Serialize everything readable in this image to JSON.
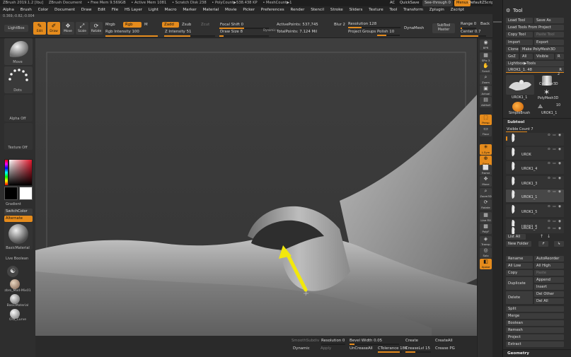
{
  "title_bar": {
    "app": "ZBrush 2019.1.2 [Ibu]",
    "document": "ZBrush Document",
    "free_mem": "• Free Mem 9.569GB",
    "active_mem": "• Active Mem 1081",
    "scratch_disk": "• Scratch Disk 238",
    "poly_count": "• PolyCount▶538.438 KP",
    "mesh_count": "• MeshCount▶1",
    "ac": "AC",
    "quicksave": "QuickSave",
    "see_through": "See-through  0",
    "menus": "Menus",
    "script": "DefaultZScript"
  },
  "menubar": [
    "Alpha",
    "Brush",
    "Color",
    "Document",
    "Draw",
    "Edit",
    "File",
    "HS Layer",
    "Light",
    "Macro",
    "Marker",
    "Material",
    "Movie",
    "Picker",
    "Preferences",
    "Render",
    "Stencil",
    "Stroke",
    "Sliders",
    "Texture",
    "Tool",
    "Transform",
    "Zplugin",
    "Zscript"
  ],
  "coords": "0.369,-0.82,-0.004",
  "top_toolbar": {
    "lightbox": "LightBox",
    "edit": "Edit",
    "draw": "Draw",
    "move": "Move",
    "scale": "Scale",
    "rotate": "Rotate",
    "mrgb": "Mrgb",
    "rgb": "Rgb",
    "m": "M",
    "rgb_intensity": "Rgb Intensity 100",
    "zadd": "Zadd",
    "zsub": "Zsub",
    "zcut": "Zcut",
    "z_intensity": "Z Intensity 51",
    "focal_shift": "Focal Shift 0",
    "draw_size": "Draw Size 8",
    "dynamic": "Dynamic",
    "active_points": "ActivePoints: 537,745",
    "total_points": "TotalPoints: 7.124 Mil",
    "blur": "Blur 2",
    "resolution": "Resolution 128",
    "project": "Project",
    "groups": "Groups",
    "polish": "Polish 10",
    "dynamesh": "DynaMesh",
    "subtool_master": "SubTool Master",
    "range": "Range 0",
    "back": "Back",
    "center": "Center 0.7"
  },
  "left_shelf": {
    "brush": "Move",
    "stroke": "Dots",
    "alpha": "Alpha Off",
    "texture": "Texture Off",
    "gradient": "Gradient",
    "switch_color": "SwitchColor",
    "alternate": "Alternate",
    "material": "BasicMaterial",
    "live_boolean": "Live Boolean",
    "mat1": "zbro_Mod-Mix01",
    "mat2": "BasicMaterial",
    "mat3": "Orb_Curve"
  },
  "right_shelf": [
    {
      "key": "bpr",
      "label": "BPR"
    },
    {
      "key": "spix",
      "label": "SPix 3"
    },
    {
      "key": "scroll",
      "label": "Scroll"
    },
    {
      "key": "zoom",
      "label": "Zoom"
    },
    {
      "key": "actual",
      "label": "Actual"
    },
    {
      "key": "aahalf",
      "label": "AAHalf"
    },
    {
      "key": "persp",
      "label": "Persp"
    },
    {
      "key": "floor",
      "label": "Floor"
    },
    {
      "key": "local",
      "label": "L.Sym"
    },
    {
      "key": "gxyz",
      "label": "Gxyz"
    },
    {
      "key": "frame",
      "label": "Frame"
    },
    {
      "key": "move",
      "label": "Move"
    },
    {
      "key": "zoom3d",
      "label": "Zoom3D"
    },
    {
      "key": "rotate",
      "label": "Rotate"
    },
    {
      "key": "linefill",
      "label": "Line Fill"
    },
    {
      "key": "polyf",
      "label": "PolyF"
    },
    {
      "key": "transp",
      "label": "Transp"
    },
    {
      "key": "solo",
      "label": "Solo"
    },
    {
      "key": "xpose",
      "label": "Xpose"
    }
  ],
  "tool_palette": {
    "header": "Tool",
    "load_tool": "Load Tool",
    "save_as": "Save As",
    "load_tools_from_project": "Load Tools From Project",
    "copy_tool": "Copy Tool",
    "paste_tool": "Paste Tool",
    "import": "Import",
    "export": "Export",
    "clone": "Clone",
    "make_polymesh": "Make PolyMesh3D",
    "goz": "GoZ",
    "all": "All",
    "visible": "Visible",
    "r": "R",
    "lightbox_tools": "Lightbox▶Tools",
    "current_tool": "UROK1_1. 48",
    "r2": "R",
    "thumbs": [
      {
        "name": "UROK1_1"
      },
      {
        "name": "Cylinder3D"
      },
      {
        "name": "PolyMesh3D"
      },
      {
        "name": "SimpleBrush"
      },
      {
        "name": "UROK1_1"
      }
    ],
    "thumb_count_2": "2",
    "thumb_count_10": "10",
    "subtool_header": "Subtool",
    "visible_count": "Visible Count 7",
    "subtools": [
      {
        "name": "",
        "selected": false
      },
      {
        "name": "UROK",
        "selected": false
      },
      {
        "name": "UROK1_4",
        "selected": false
      },
      {
        "name": "UROK1_3",
        "selected": false
      },
      {
        "name": "UROK1_1",
        "selected": true
      },
      {
        "name": "UROK1_5",
        "selected": false
      },
      {
        "name": "UROK1_6",
        "selected": false
      },
      {
        "name": "UROK1_2",
        "selected": false
      }
    ],
    "list_all": "List All",
    "new_folder": "New Folder",
    "rename": "Rename",
    "autoreorder": "AutoReorder",
    "all_low": "All Low",
    "all_high": "All High",
    "copy": "Copy",
    "paste": "Paste",
    "duplicate": "Duplicate",
    "append": "Append",
    "insert": "Insert",
    "delete": "Delete",
    "del_other": "Del Other",
    "del_all": "Del All",
    "split": "Split",
    "merge": "Merge",
    "boolean": "Boolean",
    "remesh": "Remesh",
    "project": "Project",
    "extract": "Extract",
    "geometry": "Geometry"
  },
  "bottom_bar": {
    "smooth_subdiv": "SmoothSubdiv",
    "resolution": "Resolution 0",
    "bevel_width": "Bevel Width 0.05",
    "create": "Create",
    "create_all": "CreateAll",
    "dynamic": "Dynamic",
    "apply": "Apply",
    "uncrease_all": "UnCreaseAll",
    "ctolerance": "CTolerance 180",
    "crease_lvl": "CreaseLvl 15",
    "crease_pg": "Crease PG"
  },
  "colors": {
    "accent": "#e58b1c",
    "arrow": "#f2e80c",
    "canvas_bg": "#3c3c3c"
  }
}
